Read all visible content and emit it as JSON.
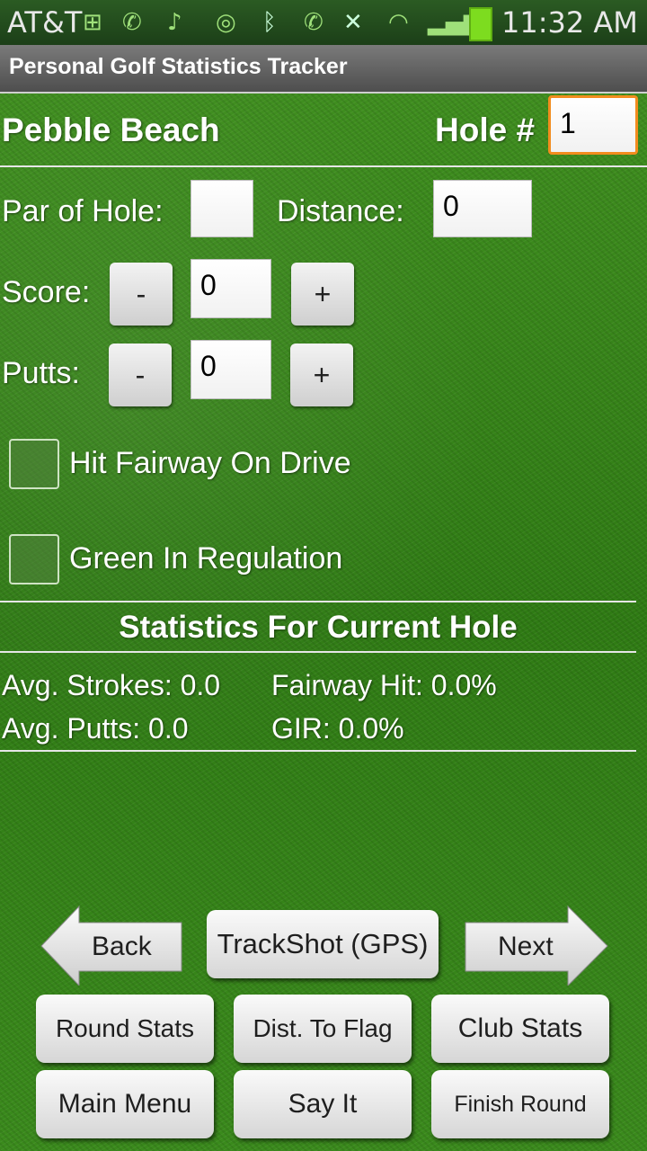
{
  "status_bar": {
    "carrier": "AT&T",
    "time": "11:32 AM",
    "battery_color": "#7ddc1f"
  },
  "app": {
    "title": "Personal Golf Statistics Tracker"
  },
  "header": {
    "course": "Pebble Beach",
    "hole_label": "Hole #",
    "hole_value": "1"
  },
  "form": {
    "par_label": "Par of Hole:",
    "par_value": "",
    "distance_label": "Distance:",
    "distance_value": "0",
    "score_label": "Score:",
    "score_value": "0",
    "putts_label": "Putts:",
    "putts_value": "0",
    "minus": "-",
    "plus": "+",
    "fairway_label": "Hit Fairway On Drive",
    "gir_label": "Green In Regulation"
  },
  "stats": {
    "heading": "Statistics For Current Hole",
    "avg_strokes": "Avg. Strokes: 0.0",
    "fairway_hit": "Fairway Hit: 0.0%",
    "avg_putts": "Avg. Putts: 0.0",
    "gir": "GIR: 0.0%"
  },
  "nav": {
    "back": "Back",
    "trackshot": "TrackShot (GPS)",
    "next": "Next"
  },
  "buttons": {
    "round_stats": "Round Stats",
    "dist_to_flag": "Dist. To Flag",
    "club_stats": "Club Stats",
    "main_menu": "Main Menu",
    "say_it": "Say It",
    "finish_round": "Finish Round"
  },
  "colors": {
    "focus": "#f28c1e",
    "grass": "#3a861b",
    "status_bg": "#1f4519"
  }
}
